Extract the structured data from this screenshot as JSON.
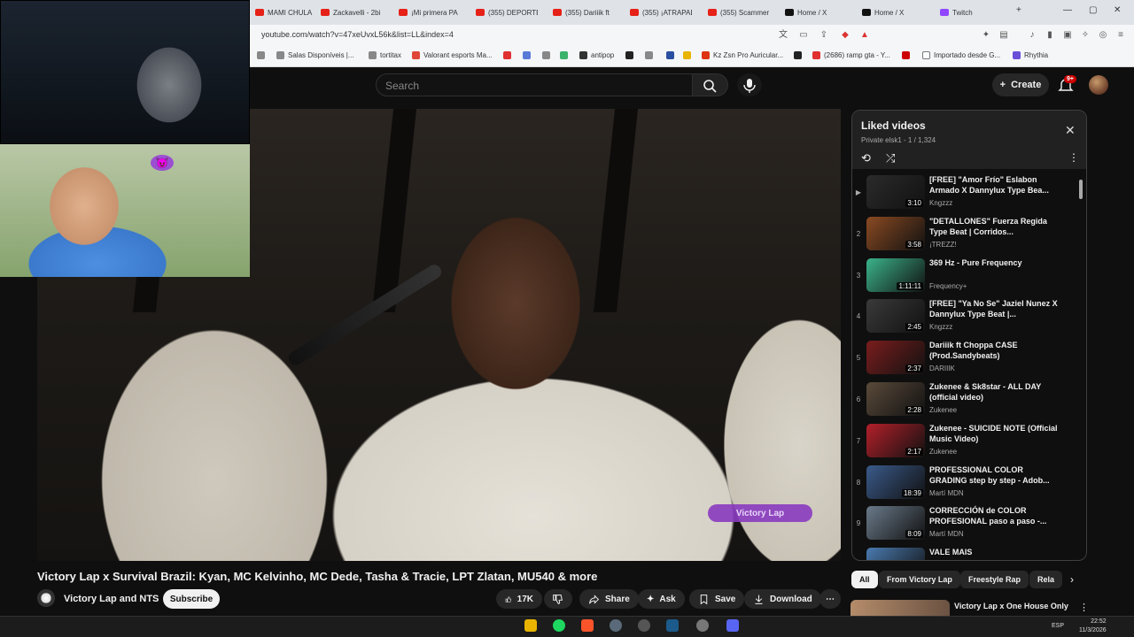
{
  "browser": {
    "tabs": [
      {
        "label": "MAMI CHULA",
        "icon": "youtube-icon"
      },
      {
        "label": "Zackavelli - 2bi",
        "icon": "youtube-icon"
      },
      {
        "label": "¡Mi primera PA",
        "icon": "youtube-icon"
      },
      {
        "label": "(355) DEPORTE",
        "icon": "youtube-icon"
      },
      {
        "label": "(355) Dariiik ft",
        "icon": "youtube-icon"
      },
      {
        "label": "(355) ¡ATRAPAD",
        "icon": "youtube-icon"
      },
      {
        "label": "(355) Scammer",
        "icon": "youtube-icon"
      },
      {
        "label": "Home / X",
        "icon": "x-icon"
      },
      {
        "label": "Home / X",
        "icon": "x-icon"
      },
      {
        "label": "Twitch",
        "icon": "twitch-icon"
      }
    ],
    "new_tab": "+",
    "url": "youtube.com/watch?v=47xeUvxL56k&list=LL&index=4",
    "bookmarks": [
      "Salas Disponíveis |...",
      "tortitax",
      "Valorant esports Ma...",
      "antipop",
      "Kz Zsn Pro Auricular...",
      "(2686) ramp gta - Y...",
      "Importado desde G...",
      "Rhythia"
    ]
  },
  "masthead": {
    "search_placeholder": "Search",
    "create_label": "Create",
    "notif_badge": "9+"
  },
  "video": {
    "watermark": "Victory Lap",
    "title": "Victory Lap x Survival Brazil: Kyan, MC Kelvinho, MC Dede, Tasha & Tracie, LPT Zlatan, MU540 & more",
    "channel": "Victory Lap and NTS",
    "subscribe": "Subscribe",
    "likes": "17K",
    "share": "Share",
    "ask": "Ask",
    "save": "Save",
    "download": "Download"
  },
  "playlist": {
    "title": "Liked videos",
    "subtitle": "Private elsk1 - 1 / 1,324",
    "items": [
      {
        "num": "▶",
        "title": "[FREE] \"Amor Frío\" Eslabon Armado X Dannylux Type Bea...",
        "channel": "Kngzzz",
        "duration": "3:10",
        "thumb": "#2b2b2b"
      },
      {
        "num": "2",
        "title": "\"DETALLONES\" Fuerza Regida Type Beat | Corridos...",
        "channel": "¡TREZZ!",
        "duration": "3:58",
        "thumb": "#8a4a22"
      },
      {
        "num": "3",
        "title": "369 Hz - Pure Frequency",
        "channel": "Frequency+",
        "duration": "1:11:11",
        "thumb": "#3bb38a"
      },
      {
        "num": "4",
        "title": "[FREE] \"Ya No Se\" Jaziel Nunez X Dannylux Type Beat |...",
        "channel": "Kngzzz",
        "duration": "2:45",
        "thumb": "#3a3a3a"
      },
      {
        "num": "5",
        "title": "Dariiik ft Choppa CASE (Prod.Sandybeats)",
        "channel": "DARIIIK",
        "duration": "2:37",
        "thumb": "#7a1d1d"
      },
      {
        "num": "6",
        "title": "Zukenee & Sk8star - ALL DAY (official video)",
        "channel": "Zukenee",
        "duration": "2:28",
        "thumb": "#5a4a3a"
      },
      {
        "num": "7",
        "title": "Zukenee - SUICIDE NOTE (Official Music Video)",
        "channel": "Zukenee",
        "duration": "2:17",
        "thumb": "#b3202a"
      },
      {
        "num": "8",
        "title": "PROFESSIONAL COLOR GRADING step by step - Adob...",
        "channel": "Martí MDN",
        "duration": "18:39",
        "thumb": "#3a5a8a"
      },
      {
        "num": "9",
        "title": "CORRECCIÓN de COLOR PROFESIONAL paso a paso -...",
        "channel": "Martí MDN",
        "duration": "8:09",
        "thumb": "#6a7a8a"
      },
      {
        "num": "10",
        "title": "VALE MAIS",
        "channel": "",
        "duration": "",
        "thumb": "#4a7ab0"
      }
    ]
  },
  "chips": [
    "All",
    "From Victory Lap",
    "Freestyle Rap",
    "Rela"
  ],
  "next": {
    "title": "Victory Lap x One House Only"
  },
  "taskbar": {
    "lang": "ESP",
    "time": "22:52",
    "date": "11/3/2026"
  },
  "colors": {
    "youtube_red": "#cc0000",
    "twitch_purple": "#9146ff",
    "watermark_purple": "#8a3bbf"
  }
}
